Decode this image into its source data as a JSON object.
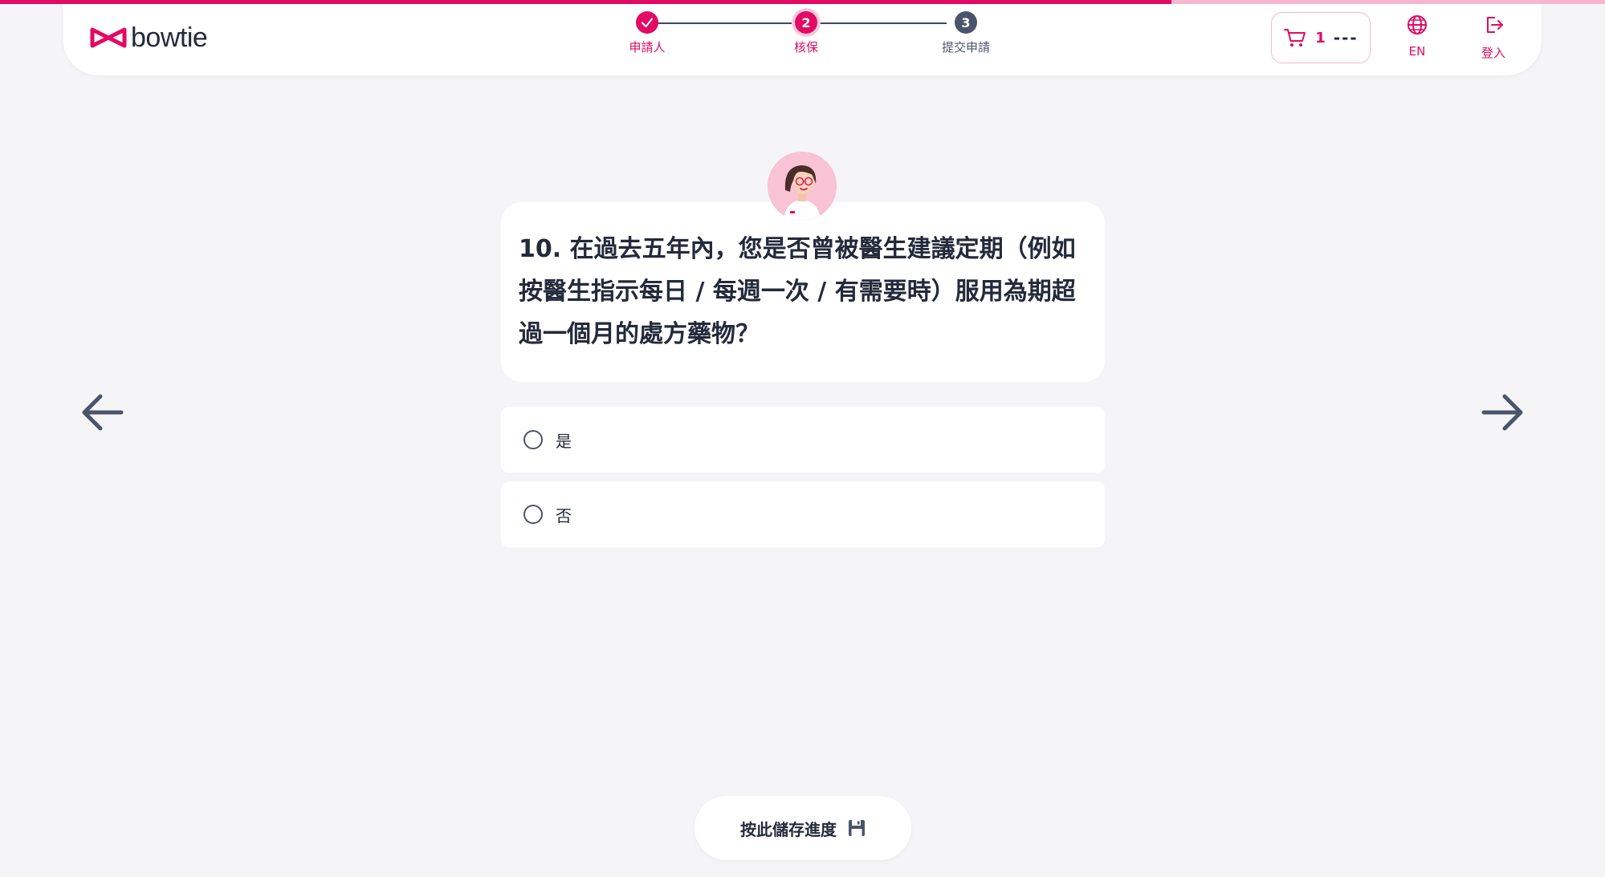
{
  "progress": {
    "fraction": 0.73
  },
  "brand": {
    "name": "bowtie",
    "color": "#e30a64"
  },
  "stepper": {
    "steps": [
      {
        "number": "1",
        "label": "申請人",
        "state": "done"
      },
      {
        "number": "2",
        "label": "核保",
        "state": "current"
      },
      {
        "number": "3",
        "label": "提交申請",
        "state": "pending"
      }
    ]
  },
  "header": {
    "cart_count": "1",
    "cart_total": "---",
    "language_label": "EN",
    "login_label": "登入"
  },
  "question": {
    "text": "10. 在過去五年內，您是否曾被醫生建議定期（例如按醫生指示每日 / 每週一次 / 有需要時）服用為期超過一個月的處方藥物？",
    "options": [
      {
        "label": "是"
      },
      {
        "label": "否"
      }
    ]
  },
  "footer": {
    "save_label": "按此儲存進度"
  },
  "colors": {
    "accent": "#e30a64",
    "text": "#232a3b",
    "background": "#f5f5f7",
    "muted": "#4a556b"
  }
}
